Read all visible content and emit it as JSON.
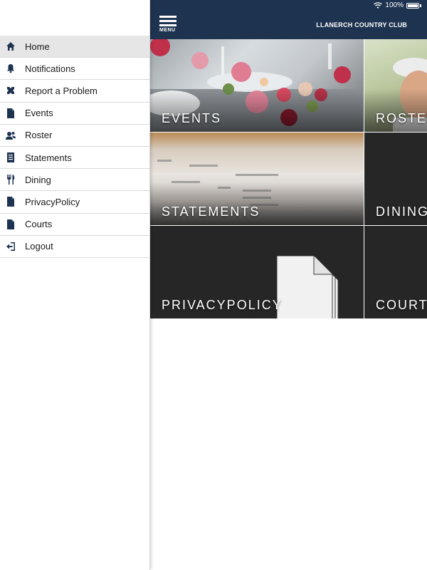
{
  "status_bar": {
    "battery_text": "100%",
    "icons": [
      "wifi-icon",
      "battery-icon"
    ]
  },
  "app_bar": {
    "menu_label": "MENU",
    "title": "LLANERCH COUNTRY CLUB"
  },
  "drawer": {
    "items": [
      {
        "label": "Home",
        "icon": "home-icon",
        "active": true
      },
      {
        "label": "Notifications",
        "icon": "bell-icon"
      },
      {
        "label": "Report a Problem",
        "icon": "tools-icon"
      },
      {
        "label": "Events",
        "icon": "document-icon"
      },
      {
        "label": "Roster",
        "icon": "people-icon"
      },
      {
        "label": "Statements",
        "icon": "statement-icon"
      },
      {
        "label": "Dining",
        "icon": "utensils-icon"
      },
      {
        "label": "PrivacyPolicy",
        "icon": "document-icon"
      },
      {
        "label": "Courts",
        "icon": "document-icon"
      },
      {
        "label": "Logout",
        "icon": "logout-icon"
      }
    ]
  },
  "tiles": [
    {
      "label": "EVENTS"
    },
    {
      "label": "ROSTER"
    },
    {
      "label": "STATEMENTS"
    },
    {
      "label": "DINING"
    },
    {
      "label": "PRIVACYPOLICY"
    },
    {
      "label": "COURTS"
    }
  ],
  "colors": {
    "navy": "#1e3350",
    "tile_dark": "#262626",
    "active_row": "#e6e6e6"
  }
}
